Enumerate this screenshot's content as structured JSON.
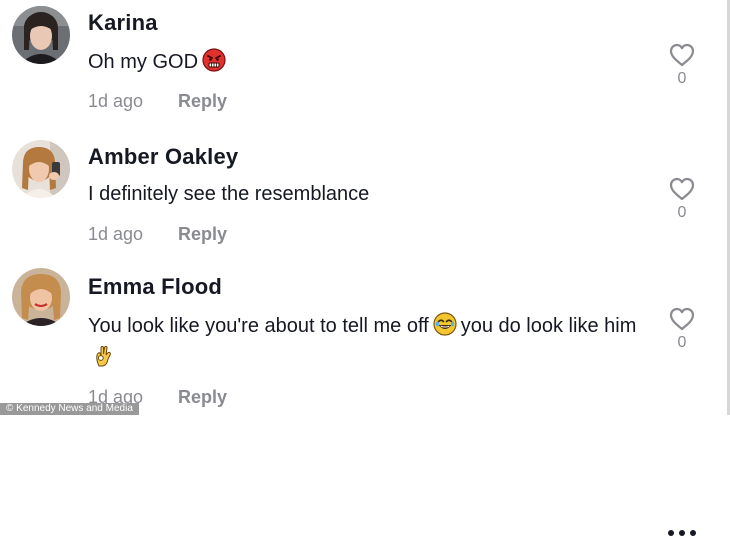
{
  "comments": [
    {
      "username": "Karina",
      "text_before": "Oh my GOD",
      "text_after": "",
      "emoji": "angry-face-emoji",
      "time": "1d ago",
      "reply": "Reply",
      "likes": "0"
    },
    {
      "username": "Amber Oakley",
      "text_before": "I definitely see the resemblance",
      "text_after": "",
      "emoji": "",
      "time": "1d ago",
      "reply": "Reply",
      "likes": "0"
    },
    {
      "username": "Emma Flood",
      "text_before": "You look like you're about to tell me off",
      "text_middle": "you do look like him",
      "emoji": "laughing-emoji",
      "emoji_end": "ok-hand-emoji",
      "time": "1d ago",
      "reply": "Reply",
      "likes": "0"
    }
  ],
  "watermark": "© Kennedy News and Media",
  "colors": {
    "text": "#161823",
    "muted": "#8a8b91",
    "background": "#ffffff"
  }
}
